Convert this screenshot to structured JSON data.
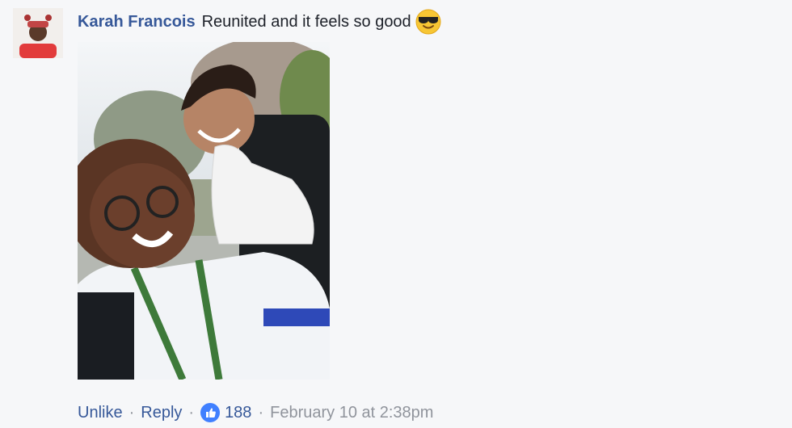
{
  "comment": {
    "author": "Karah Francois",
    "text": "Reunited and it feels so good",
    "emoji": "sunglasses-emoji",
    "actions": {
      "unlike_label": "Unlike",
      "separator": "·",
      "reply_label": "Reply",
      "like_icon": "thumbs-up-icon",
      "like_count": "188",
      "timestamp": "February 10 at 2:38pm"
    }
  },
  "colors": {
    "link": "#365899",
    "meta": "#90949c",
    "background": "#f6f7f9",
    "like_badge": "#4080ff"
  }
}
